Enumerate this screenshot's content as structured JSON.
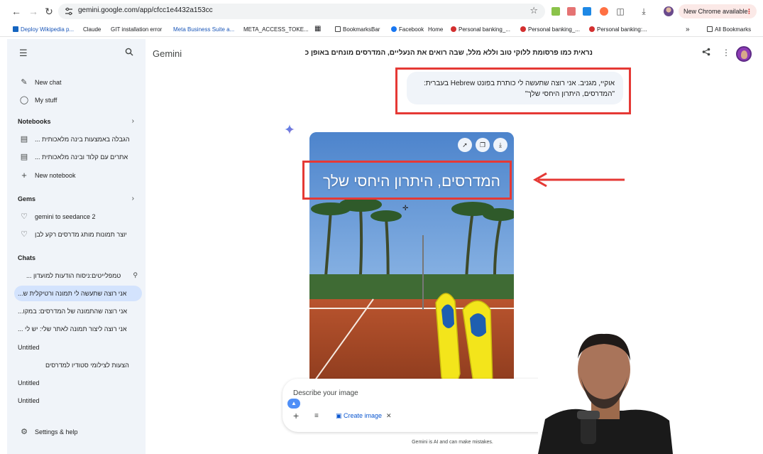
{
  "browser": {
    "url": "gemini.google.com/app/cfcc1e4432a153cc",
    "update_label": "New Chrome available",
    "bookmarks": [
      "Deploy Wikipedia p...",
      "Claude",
      "GIT installation error",
      "Meta Business Suite a...",
      "META_ACCESS_TOKE...",
      "BookmarksBar",
      "Facebook",
      "Home",
      "Personal banking_...",
      "Personal banking_...",
      "Personal banking:...",
      "All Bookmarks"
    ]
  },
  "sidebar": {
    "new_chat": "New chat",
    "my_stuff": "My stuff",
    "notebooks_title": "Notebooks",
    "notebooks": [
      "הגבלה באמצעות בינה מלאכותית ...",
      "אתרים עם קלוד ובינה מלאכותית ..."
    ],
    "new_notebook": "New notebook",
    "gems_title": "Gems",
    "gems": [
      "gemini to seedance 2",
      "יוצר תמונות מותג מדרסים רקע לבן"
    ],
    "chats_title": "Chats",
    "chats": [
      "טמפלייטים:ניסוח הודעות למועדון ...",
      "אני רוצה שתעשה לי תמונה ורטיקלית ש...",
      "אני רוצה שהתמונה של המדרסים: במקו...",
      "אני רוצה ליצור תמונה לאתר שלי: יש לי ...",
      "Untitled",
      "הצעות לצילומי סטודיו למדרסים",
      "Untitled",
      "Untitled"
    ],
    "settings": "Settings & help"
  },
  "main": {
    "app_title": "Gemini",
    "conversation_title": "נראית כמו פרסומת ללוקי טוב וללא מלל, שבה רואים את הנעליים, המדרסים מונחים באופן כ",
    "user_message_line1": "אוקיי, מגניב. אני רוצה שתעשה לי כותרת בפונט Hebrew בעברית:",
    "user_message_line2": "\"המדרסים, היתרון היחסי שלך\"",
    "image_headline": "המדרסים, היתרון היחסי שלך",
    "composer_placeholder": "Describe your image",
    "create_image_label": "Create image",
    "disclaimer": "Gemini is AI and can make mistakes."
  },
  "colors": {
    "sidebar_bg": "#f0f4f9",
    "active_chat_bg": "#d3e3fd",
    "annotation_red": "#e53935",
    "accent_blue": "#0b57d0"
  }
}
